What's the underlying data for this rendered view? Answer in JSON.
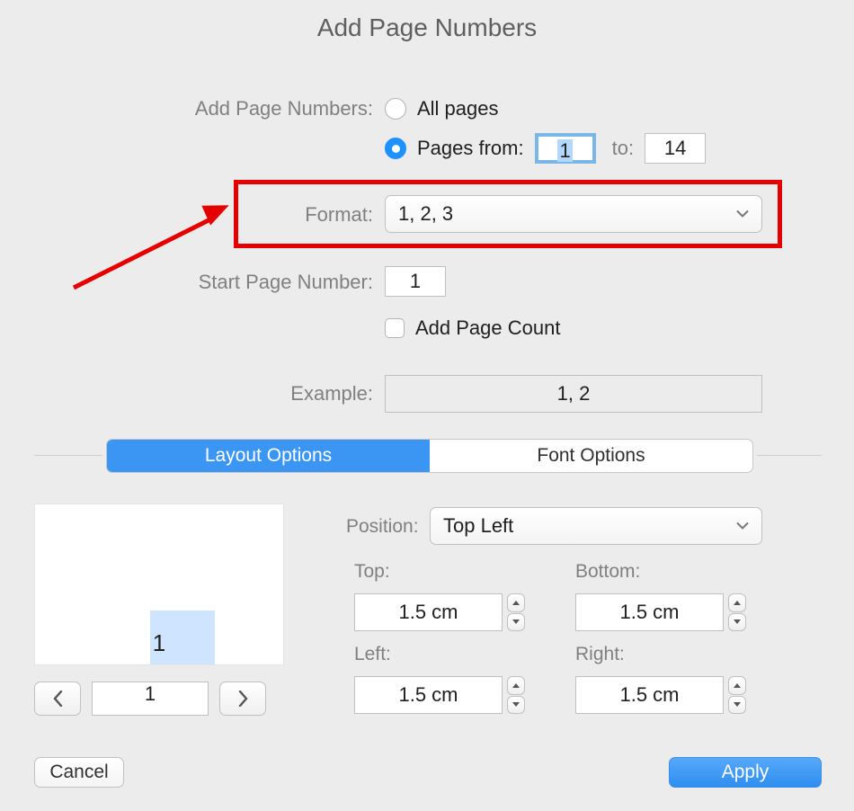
{
  "title": "Add Page Numbers",
  "labels": {
    "add_page_numbers": "Add Page Numbers:",
    "all_pages": "All pages",
    "pages_from": "Pages from:",
    "to": "to:",
    "format": "Format:",
    "start_page_number": "Start Page Number:",
    "add_page_count": "Add Page Count",
    "example": "Example:",
    "position": "Position:",
    "top": "Top:",
    "bottom": "Bottom:",
    "left": "Left:",
    "right": "Right:"
  },
  "range": {
    "from": "1",
    "to": "14"
  },
  "format_selected": "1, 2, 3",
  "start_page_number": "1",
  "example_value": "1, 2",
  "tabs": {
    "layout": "Layout Options",
    "font": "Font Options"
  },
  "position_selected": "Top Left",
  "margins": {
    "top": "1.5 cm",
    "bottom": "1.5 cm",
    "left": "1.5 cm",
    "right": "1.5 cm"
  },
  "preview": {
    "page_indicator": "1",
    "current_page": "1"
  },
  "buttons": {
    "cancel": "Cancel",
    "apply": "Apply"
  }
}
